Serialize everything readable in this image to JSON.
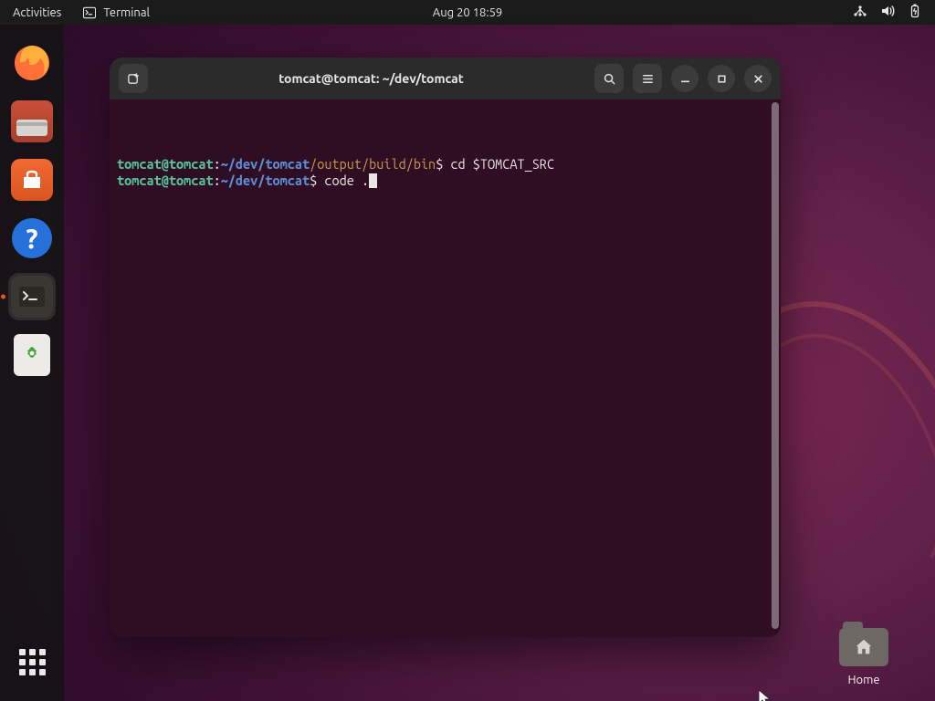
{
  "topbar": {
    "activities": "Activities",
    "app_name": "Terminal",
    "clock": "Aug 20  18:59"
  },
  "dock": {
    "items": [
      {
        "name": "firefox"
      },
      {
        "name": "files"
      },
      {
        "name": "software"
      },
      {
        "name": "help"
      },
      {
        "name": "terminal"
      },
      {
        "name": "trash"
      }
    ]
  },
  "desktop": {
    "home_label": "Home"
  },
  "terminal": {
    "title": "tomcat@tomcat: ~/dev/tomcat",
    "lines": [
      {
        "user": "tomcat@tomcat",
        "colon": ":",
        "path": "~/dev/tomcat",
        "subpath": "/output/build/bin",
        "dollar": "$ ",
        "cmd": "cd $TOMCAT_SRC"
      },
      {
        "user": "tomcat@tomcat",
        "colon": ":",
        "path": "~/dev/tomcat",
        "subpath": "",
        "dollar": "$ ",
        "cmd": "code .",
        "cursor": true
      }
    ]
  }
}
